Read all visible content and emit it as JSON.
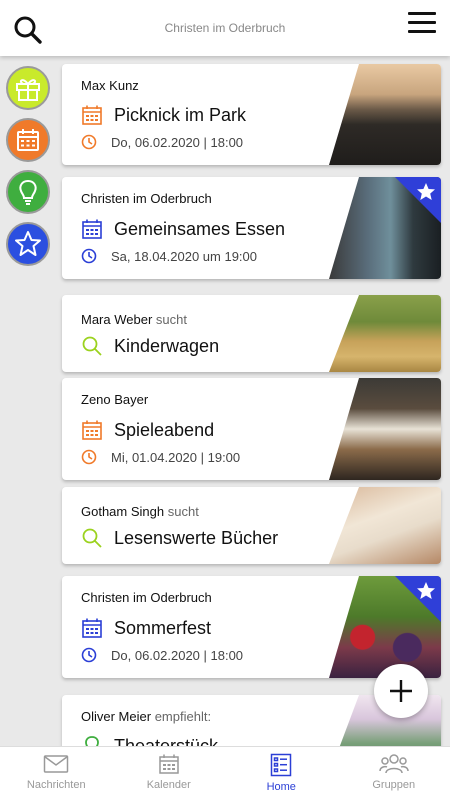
{
  "header": {
    "title": "Christen im Oderbruch"
  },
  "sidebar": {
    "items": [
      {
        "name": "gift",
        "color": "#c9ea2b"
      },
      {
        "name": "calendar",
        "color": "#f07a2a"
      },
      {
        "name": "lightbulb",
        "color": "#3fae3f"
      },
      {
        "name": "star",
        "color": "#2b4fe0"
      }
    ]
  },
  "cards": [
    {
      "author": "Max Kunz",
      "suffix": "",
      "title": "Picknick im Park",
      "date": "Do, 06.02.2020 | 18:00",
      "icon": "calendar-icon",
      "accent": "#f07a2a",
      "favorite": false
    },
    {
      "author": "Christen im Oderbruch",
      "suffix": "",
      "title": "Gemeinsames Essen",
      "date": "Sa, 18.04.2020 um 19:00",
      "icon": "calendar-icon",
      "accent": "#2b3fd6",
      "favorite": true
    },
    {
      "author": "Mara Weber",
      "suffix": "sucht",
      "title": "Kinderwagen",
      "date": "",
      "icon": "search-icon",
      "accent": "#9bd21e",
      "favorite": false
    },
    {
      "author": "Zeno Bayer",
      "suffix": "",
      "title": "Spieleabend",
      "date": "Mi, 01.04.2020 | 19:00",
      "icon": "calendar-icon",
      "accent": "#f07a2a",
      "favorite": false
    },
    {
      "author": "Gotham Singh",
      "suffix": "sucht",
      "title": "Lesenswerte Bücher",
      "date": "",
      "icon": "search-icon",
      "accent": "#9bd21e",
      "favorite": false
    },
    {
      "author": "Christen im Oderbruch",
      "suffix": "",
      "title": "Sommerfest",
      "date": "Do, 06.02.2020 | 18:00",
      "icon": "calendar-icon",
      "accent": "#2b3fd6",
      "favorite": true
    },
    {
      "author": "Oliver Meier",
      "suffix": "empfiehlt:",
      "title": "Theaterstück",
      "date": "",
      "icon": "lightbulb-icon",
      "accent": "#3fae3f",
      "favorite": false
    }
  ],
  "nav": [
    {
      "label": "Nachrichten",
      "icon": "mail-icon",
      "active": false
    },
    {
      "label": "Kalender",
      "icon": "calendar-icon",
      "active": false
    },
    {
      "label": "Home",
      "icon": "list-icon",
      "active": true
    },
    {
      "label": "Gruppen",
      "icon": "group-icon",
      "active": false
    }
  ],
  "colors": {
    "active": "#2b3fd6",
    "favorite_badge": "#2f3fd8"
  }
}
